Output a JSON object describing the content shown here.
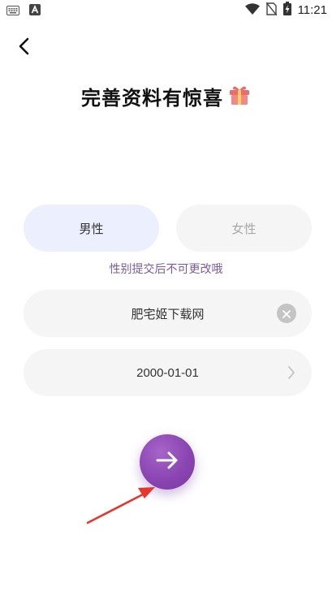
{
  "status_bar": {
    "time": "11:21",
    "icons": [
      "keyboard-icon",
      "a-box-icon",
      "wifi-icon",
      "no-sim-icon",
      "battery-charging-icon"
    ]
  },
  "header": {
    "back_icon": "back-arrow-icon",
    "title": "完善资料有惊喜",
    "title_icon": "gift-icon"
  },
  "gender": {
    "male_label": "男性",
    "female_label": "女性",
    "selected": "male",
    "hint": "性别提交后不可更改哦"
  },
  "nickname": {
    "value": "肥宅姬下载网",
    "clear_icon": "clear-icon"
  },
  "birthday": {
    "value": "2000-01-01",
    "chevron_icon": "chevron-right-icon"
  },
  "submit": {
    "icon": "arrow-right-icon"
  },
  "colors": {
    "accent": "#8a45b2",
    "hint": "#7a5aa6",
    "selected_bg": "#eceffd",
    "field_bg": "#f5f5f5",
    "annotation": "#e8362d"
  }
}
